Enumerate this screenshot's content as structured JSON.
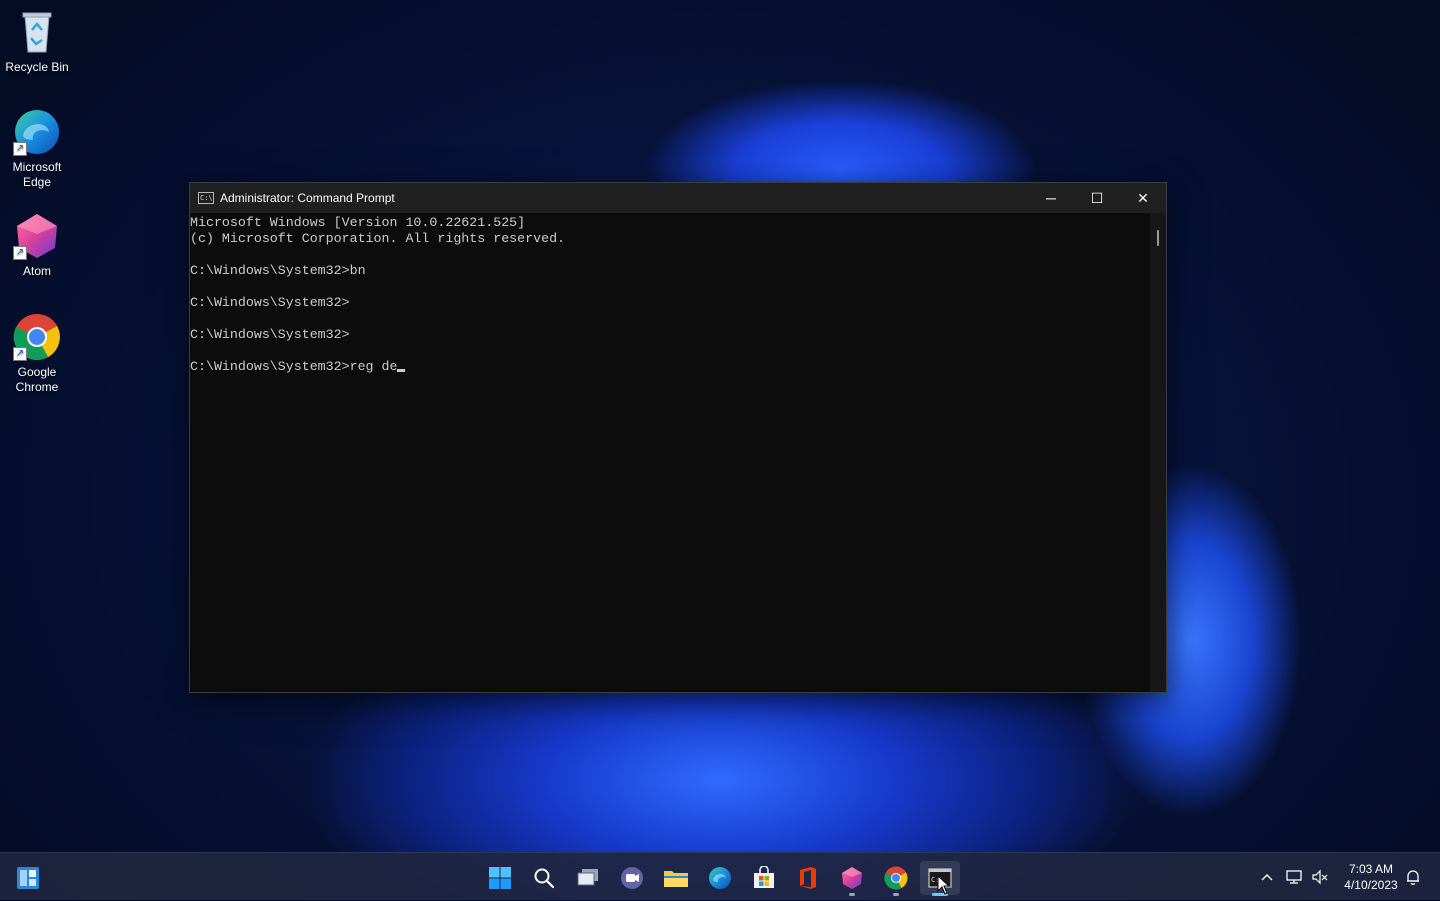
{
  "desktop": {
    "icons": [
      {
        "label": "Recycle Bin"
      },
      {
        "label": "Microsoft Edge"
      },
      {
        "label": "Atom"
      },
      {
        "label": "Google Chrome"
      }
    ]
  },
  "window": {
    "title": "Administrator: Command Prompt",
    "app_icon_text": "C:\\",
    "controls": {
      "minimize": "─",
      "maximize": "☐",
      "close": "✕"
    },
    "console_lines": [
      "Microsoft Windows [Version 10.0.22621.525]",
      "(c) Microsoft Corporation. All rights reserved.",
      "",
      "C:\\Windows\\System32>bn",
      "",
      "C:\\Windows\\System32>",
      "",
      "C:\\Windows\\System32>",
      "",
      "C:\\Windows\\System32>reg de"
    ]
  },
  "taskbar": {
    "apps": [
      {
        "name": "start-button",
        "icon": "windows-logo-icon"
      },
      {
        "name": "search-button",
        "icon": "search-icon"
      },
      {
        "name": "task-view-button",
        "icon": "task-view-icon"
      },
      {
        "name": "chat-button",
        "icon": "teams-chat-icon"
      },
      {
        "name": "file-explorer-button",
        "icon": "folder-icon"
      },
      {
        "name": "edge-button",
        "icon": "edge-icon"
      },
      {
        "name": "store-button",
        "icon": "store-icon"
      },
      {
        "name": "office-button",
        "icon": "office-icon"
      },
      {
        "name": "atom-button",
        "icon": "atom-icon"
      },
      {
        "name": "chrome-button",
        "icon": "chrome-icon"
      },
      {
        "name": "terminal-button",
        "icon": "command-prompt-icon"
      }
    ],
    "clock": {
      "time": "7:03 AM",
      "date": "4/10/2023"
    }
  },
  "colors": {
    "accent": "#60cdff",
    "console_bg": "#0c0c0c",
    "console_fg": "#cccccc",
    "titlebar": "#202020"
  }
}
